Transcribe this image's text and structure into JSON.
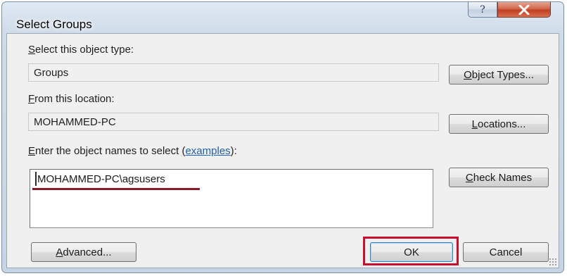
{
  "window": {
    "title": "Select Groups",
    "help_glyph": "?",
    "close_glyph": "X"
  },
  "object_type": {
    "label_pre": "",
    "label_ul": "S",
    "label_post": "elect this object type:",
    "value": "Groups",
    "button_ul": "O",
    "button_post": "bject Types..."
  },
  "location": {
    "label_pre": "",
    "label_ul": "F",
    "label_post": "rom this location:",
    "value": "MOHAMMED-PC",
    "button_pre": "",
    "button_ul": "L",
    "button_post": "ocations..."
  },
  "names": {
    "label_ul": "E",
    "label_post": "nter the object names to select (",
    "link": "examples",
    "label_end": "):",
    "value": "MOHAMMED-PC\\agsusers",
    "check_ul": "C",
    "check_post": "heck Names"
  },
  "footer": {
    "advanced_ul": "A",
    "advanced_post": "dvanced...",
    "ok_label": "OK",
    "cancel_label": "Cancel"
  },
  "colors": {
    "highlight": "#c8102e",
    "underline_mark": "#8a1a2a",
    "link": "#2060b0"
  }
}
